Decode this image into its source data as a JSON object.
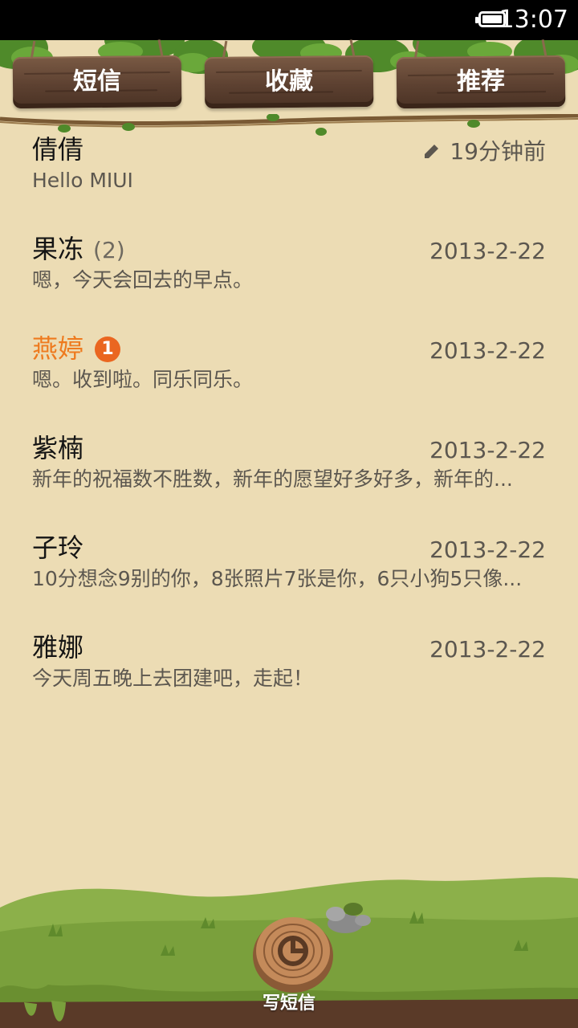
{
  "status_bar": {
    "time": "13:07"
  },
  "tabs": [
    {
      "label": "短信",
      "active": true
    },
    {
      "label": "收藏",
      "active": false
    },
    {
      "label": "推荐",
      "active": false
    }
  ],
  "conversations": [
    {
      "name": "倩倩",
      "count": "",
      "unread_badge": "",
      "date": "19分钟前",
      "draft": true,
      "preview": "Hello MIUI"
    },
    {
      "name": "果冻",
      "count": "(2)",
      "unread_badge": "",
      "date": "2013-2-22",
      "draft": false,
      "preview": "嗯，今天会回去的早点。"
    },
    {
      "name": "燕婷",
      "count": "",
      "unread_badge": "1",
      "date": "2013-2-22",
      "draft": false,
      "preview": "嗯。收到啦。同乐同乐。"
    },
    {
      "name": "紫楠",
      "count": "",
      "unread_badge": "",
      "date": "2013-2-22",
      "draft": false,
      "preview": "新年的祝福数不胜数，新年的愿望好多好多，新年的..."
    },
    {
      "name": "子玲",
      "count": "",
      "unread_badge": "",
      "date": "2013-2-22",
      "draft": false,
      "preview": "10分想念9别的你，8张照片7张是你，6只小狗5只像..."
    },
    {
      "name": "雅娜",
      "count": "",
      "unread_badge": "",
      "date": "2013-2-22",
      "draft": false,
      "preview": "今天周五晚上去团建吧，走起！"
    }
  ],
  "compose": {
    "label": "写短信"
  },
  "colors": {
    "background": "#ecdcb4",
    "unread_name": "#ee7a1e",
    "badge": "#ea6620",
    "wood": "#5d4131",
    "grass": "#8cb04a"
  },
  "icons": [
    "battery-icon",
    "pencil-icon",
    "compose-stump-icon"
  ]
}
